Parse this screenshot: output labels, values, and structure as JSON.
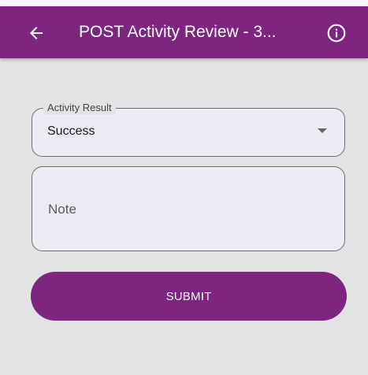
{
  "appbar": {
    "title": "POST Activity Review - 3...",
    "back_icon": "arrow-left-icon",
    "info_icon": "info-circle-icon",
    "background_color": "#7d2581"
  },
  "form": {
    "activity_result": {
      "label": "Activity Result",
      "value": "Success",
      "arrow_icon": "caret-down-icon"
    },
    "note": {
      "placeholder": "Note"
    },
    "submit_label": "SUBMIT"
  }
}
